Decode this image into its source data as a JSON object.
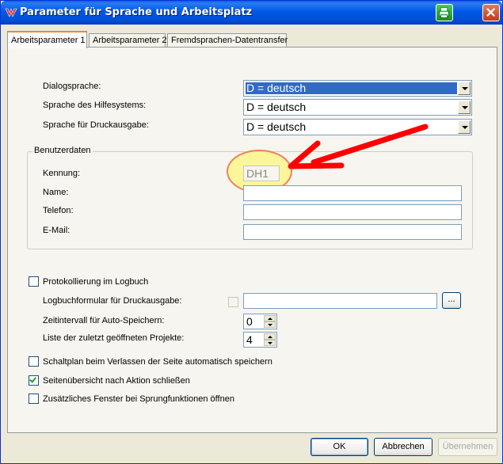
{
  "window": {
    "title": "Parameter für Sprache und Arbeitsplatz",
    "app_icon": "app-logo-icon",
    "print_icon": "printer-icon",
    "close_icon": "close-icon"
  },
  "tabs": [
    {
      "label": "Arbeitsparameter 1",
      "active": true
    },
    {
      "label": "Arbeitsparameter 2",
      "active": false
    },
    {
      "label": "Fremdsprachen-Datentransfer",
      "active": false
    }
  ],
  "language": {
    "dialog_label": "Dialogsprache:",
    "dialog_value": "D = deutsch",
    "help_label": "Sprache des Hilfesystems:",
    "help_value": "D = deutsch",
    "print_label": "Sprache für Druckausgabe:",
    "print_value": "D = deutsch"
  },
  "user": {
    "group_title": "Benutzerdaten",
    "id_label": "Kennung:",
    "id_value": "DH1",
    "name_label": "Name:",
    "name_value": "",
    "phone_label": "Telefon:",
    "phone_value": "",
    "email_label": "E-Mail:",
    "email_value": ""
  },
  "logging": {
    "protocol_label": "Protokollierung im Logbuch",
    "protocol_checked": false,
    "form_label": "Logbuchformular für Druckausgabe:",
    "form_checked": false,
    "form_value": "",
    "browse_label": "...",
    "autosave_label": "Zeitintervall für Auto-Speichern:",
    "autosave_value": "0",
    "recent_label": "Liste der zuletzt geöffneten Projekte:",
    "recent_value": "4"
  },
  "options": {
    "save_on_leave_label": "Schaltplan beim Verlassen der Seite automatisch speichern",
    "save_on_leave_checked": false,
    "close_overview_label": "Seitenübersicht nach Aktion schließen",
    "close_overview_checked": true,
    "extra_window_label": "Zusätzliches Fenster bei Sprungfunktionen öffnen",
    "extra_window_checked": false
  },
  "buttons": {
    "ok": "OK",
    "cancel": "Abbrechen",
    "apply": "Übernehmen"
  },
  "annotation": {
    "arrow_color": "#ff0000",
    "highlight_color": "#fff778"
  }
}
